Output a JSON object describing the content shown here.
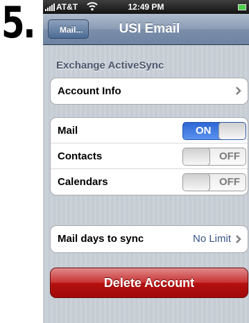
{
  "step_number": "5.",
  "status_bar": {
    "carrier": "AT&T",
    "time": "12:49 PM",
    "icons": [
      "signal-bars-icon",
      "wifi-icon",
      "battery-icon"
    ]
  },
  "nav_bar": {
    "back_label": "Mail...",
    "title": "USI Email"
  },
  "section_header": "Exchange ActiveSync",
  "account_group": {
    "account_info_label": "Account Info"
  },
  "sync_group": {
    "mail": {
      "label": "Mail",
      "toggle": "ON"
    },
    "contacts": {
      "label": "Contacts",
      "toggle": "OFF"
    },
    "calendars": {
      "label": "Calendars",
      "toggle": "OFF"
    }
  },
  "days_group": {
    "label": "Mail days to sync",
    "value": "No Limit"
  },
  "delete_button_label": "Delete Account",
  "colors": {
    "toggle_on": "#2e67d4",
    "delete": "#b51010",
    "value_text": "#385487",
    "background": "#c5ccd4"
  }
}
